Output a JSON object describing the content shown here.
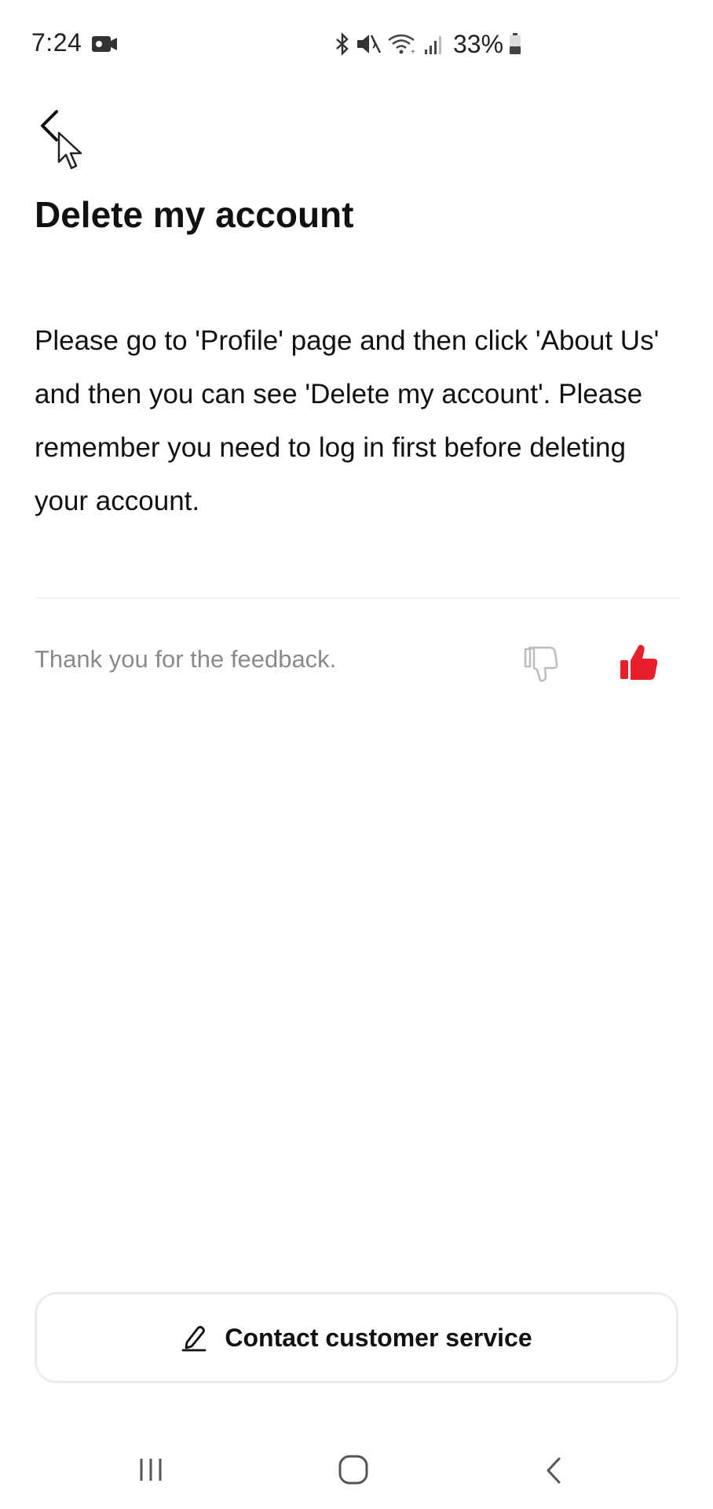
{
  "status_bar": {
    "time": "7:24",
    "battery": "33%",
    "icons": [
      "video-recording-icon",
      "bluetooth-icon",
      "mute-icon",
      "wifi-icon",
      "signal-icon",
      "battery-icon"
    ]
  },
  "header": {
    "back_icon": "chevron-left-icon"
  },
  "page": {
    "title": "Delete my account",
    "answer": "Please go to 'Profile' page and then click 'About Us' and then you can see 'Delete my account'. Please remember you need to log in first before deleting your account."
  },
  "feedback": {
    "message": "Thank you for the feedback.",
    "thumbs_down_selected": false,
    "thumbs_up_selected": true,
    "accent_color": "#e8202a"
  },
  "contact": {
    "label": "Contact customer service",
    "icon": "pen-icon"
  },
  "nav": {
    "icons": [
      "recents-icon",
      "home-icon",
      "back-icon"
    ]
  }
}
